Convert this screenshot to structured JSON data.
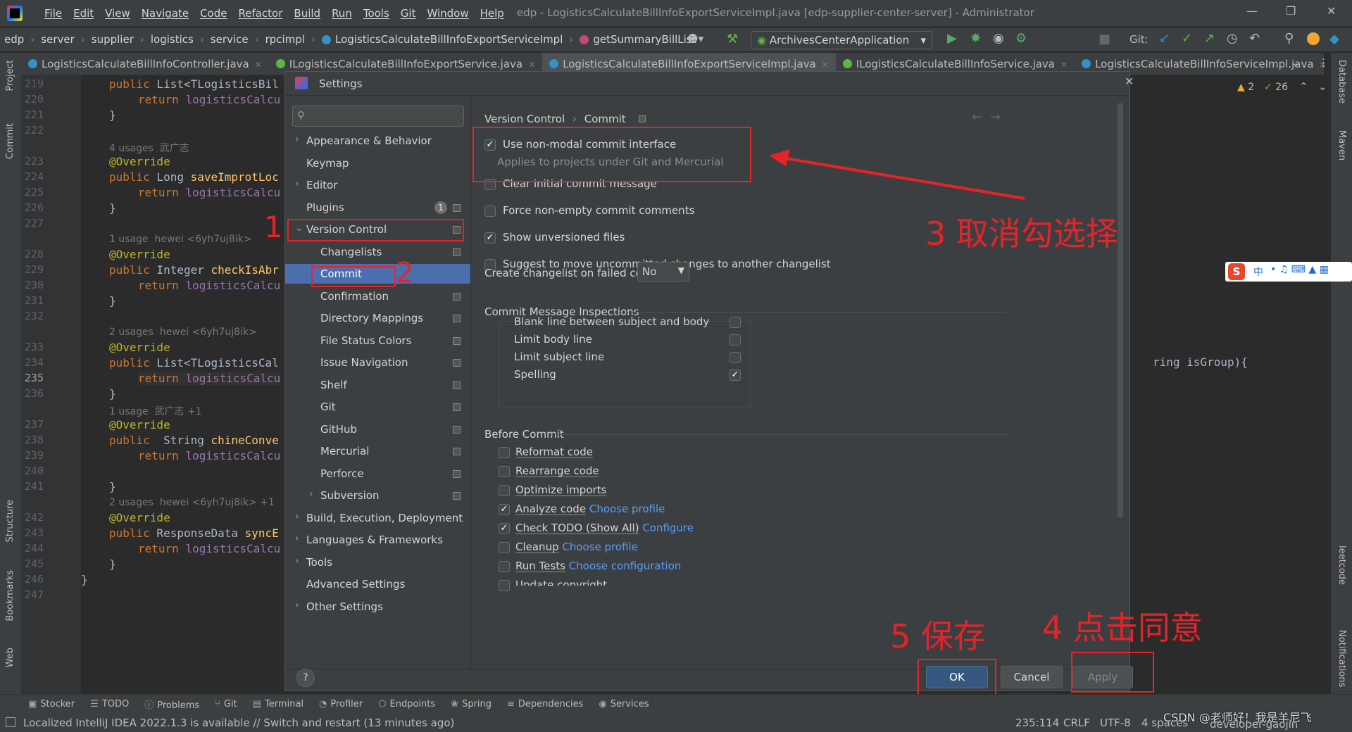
{
  "titlebar": {
    "menus": [
      "File",
      "Edit",
      "View",
      "Navigate",
      "Code",
      "Refactor",
      "Build",
      "Run",
      "Tools",
      "Git",
      "Window",
      "Help"
    ],
    "title": "edp - LogisticsCalculateBillInfoExportServiceImpl.java [edp-supplier-center-server] - Administrator"
  },
  "navbar": {
    "breadcrumb": [
      "edp",
      "server",
      "supplier",
      "logistics",
      "service",
      "rpcimpl",
      "LogisticsCalculateBillInfoExportServiceImpl",
      "getSummaryBillList"
    ],
    "run_config": "ArchivesCenterApplication",
    "git_label": "Git:"
  },
  "tabs": [
    "LogisticsCalculateBillInfoController.java",
    "ILogisticsCalculateBillInfoExportService.java",
    "LogisticsCalculateBillInfoExportServiceImpl.java",
    "ILogisticsCalculateBillInfoService.java",
    "LogisticsCalculateBillInfoServiceImpl.java"
  ],
  "left_tools": [
    "Project",
    "Commit",
    "Structure",
    "Bookmarks",
    "Web"
  ],
  "right_tools": [
    "Database",
    "Maven",
    "leetcode",
    "Notifications"
  ],
  "editor": {
    "warnings": "2",
    "checks": "26",
    "line_numbers": [
      "219",
      "220",
      "221",
      "222",
      "223",
      "224",
      "225",
      "226",
      "227",
      "228",
      "229",
      "230",
      "231",
      "232",
      "233",
      "234",
      "235",
      "236",
      "237",
      "238",
      "239",
      "240",
      "241",
      "242",
      "243",
      "244",
      "245",
      "246",
      "247"
    ],
    "hints": [
      "4 usages  武广志",
      "1 usage  hewei <6yh7uj8ik>",
      "2 usages  hewei <6yh7uj8ik>",
      "1 usage  武广志 +1",
      "2 usages  hewei <6yh7uj8ik> +1"
    ],
    "right_code": "ring isGroup){"
  },
  "dialog": {
    "title": "Settings",
    "search_placeholder": "",
    "tree": [
      "Appearance & Behavior",
      "Keymap",
      "Editor",
      "Plugins",
      "Version Control",
      "Changelists",
      "Commit",
      "Confirmation",
      "Directory Mappings",
      "File Status Colors",
      "Issue Navigation",
      "Shelf",
      "Git",
      "GitHub",
      "Mercurial",
      "Perforce",
      "Subversion",
      "Build, Execution, Deployment",
      "Languages & Frameworks",
      "Tools",
      "Advanced Settings",
      "Other Settings"
    ],
    "plugins_badge": "1",
    "breadcrumb": [
      "Version Control",
      "Commit"
    ],
    "options": [
      {
        "label": "Use non-modal commit interface",
        "checked": true
      },
      {
        "label": "Clear initial commit message",
        "checked": false
      },
      {
        "label": "Force non-empty commit comments",
        "checked": false
      },
      {
        "label": "Show unversioned files",
        "checked": true
      },
      {
        "label": "Suggest to move uncommitted changes to another changelist",
        "checked": false
      }
    ],
    "non_modal_note": "Applies to projects under Git and Mercurial",
    "changelist_label": "Create changelist on failed commit:",
    "changelist_value": "No",
    "inspections_title": "Commit Message Inspections",
    "inspections": [
      {
        "label": "Blank line between subject and body",
        "checked": false
      },
      {
        "label": "Limit body line",
        "checked": false
      },
      {
        "label": "Limit subject line",
        "checked": false
      },
      {
        "label": "Spelling",
        "checked": true
      }
    ],
    "before_commit_title": "Before Commit",
    "before_commit": [
      {
        "label": "Reformat code",
        "checked": false,
        "link": ""
      },
      {
        "label": "Rearrange code",
        "checked": false,
        "link": ""
      },
      {
        "label": "Optimize imports",
        "checked": false,
        "link": ""
      },
      {
        "label": "Analyze code",
        "checked": true,
        "link": "Choose profile"
      },
      {
        "label": "Check TODO (Show All)",
        "checked": true,
        "link": "Configure"
      },
      {
        "label": "Cleanup",
        "checked": false,
        "link": "Choose profile"
      },
      {
        "label": "Run Tests",
        "checked": false,
        "link": "Choose configuration"
      },
      {
        "label": "Update copyright",
        "checked": false,
        "link": ""
      }
    ],
    "buttons": {
      "ok": "OK",
      "cancel": "Cancel",
      "apply": "Apply",
      "help": "?"
    }
  },
  "annotations": [
    "1",
    "2",
    "3 取消勾选择",
    "4 点击同意",
    "5 保存"
  ],
  "ime": "中",
  "toolstrip": [
    "Stocker",
    "TODO",
    "Problems",
    "Git",
    "Terminal",
    "Profiler",
    "Endpoints",
    "Spring",
    "Dependencies",
    "Services"
  ],
  "status": {
    "message": "Localized IntelliJ IDEA 2022.1.3 is available // Switch and restart (13 minutes ago)",
    "position": "235:114",
    "eol": "CRLF",
    "encoding": "UTF-8",
    "indent": "4 spaces",
    "branch": "developer-gaojin",
    "watermark": "CSDN @老师好！我是羊尼飞"
  },
  "colors": {
    "accent": "#4b6eaf",
    "annotation_red": "#e5242a",
    "ok_button": "#365880"
  }
}
